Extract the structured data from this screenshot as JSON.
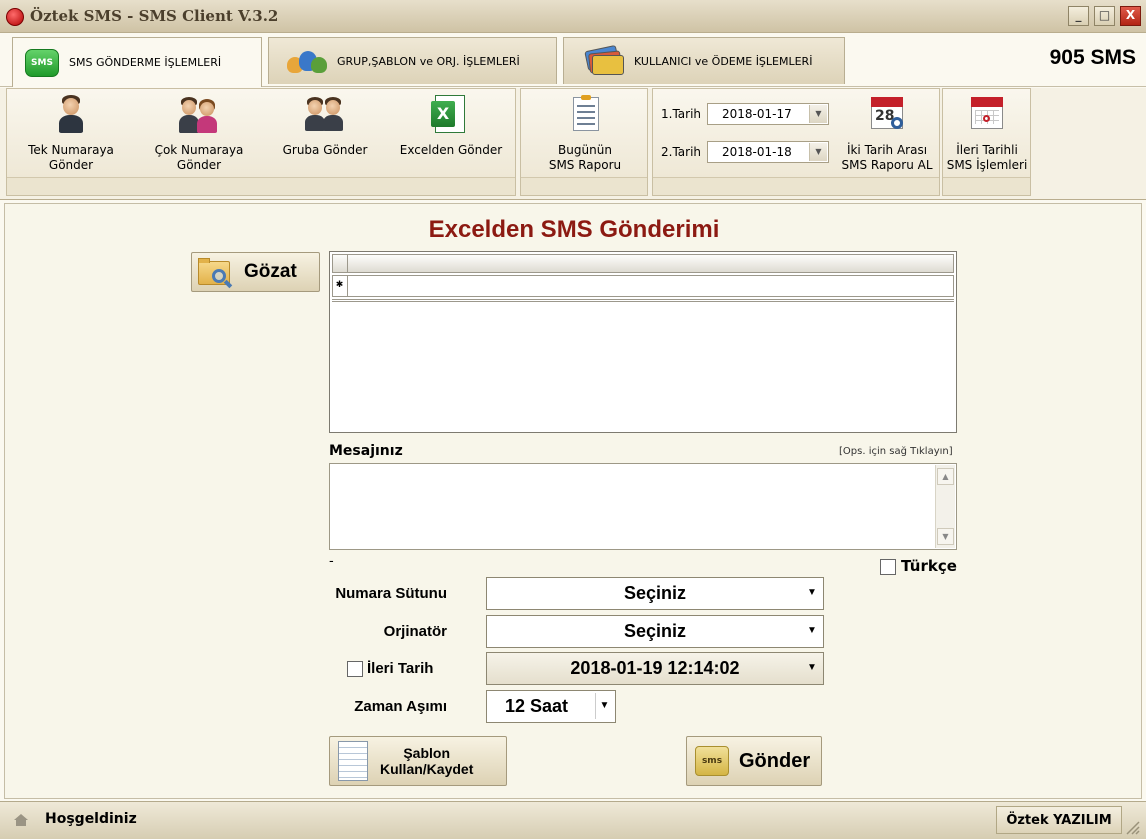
{
  "window": {
    "title": "Öztek SMS - SMS Client  V.3.2",
    "min": "_",
    "max": "□",
    "close": "X"
  },
  "tabs": [
    {
      "label": "SMS GÖNDERME İŞLEMLERİ"
    },
    {
      "label": "GRUP,ŞABLON ve ORJ. İŞLEMLERİ"
    },
    {
      "label": "KULLANICI ve ÖDEME İŞLEMLERİ"
    }
  ],
  "credit": "905 SMS",
  "ribbon": {
    "send": [
      {
        "line1": "Tek Numaraya",
        "line2": "Gönder"
      },
      {
        "line1": "Çok Numaraya",
        "line2": "Gönder"
      },
      {
        "line1": "Gruba Gönder",
        "line2": ""
      },
      {
        "line1": "Excelden Gönder",
        "line2": ""
      }
    ],
    "today_report": {
      "line1": "Bugünün",
      "line2": "SMS Raporu"
    },
    "date1_label": "1.Tarih",
    "date1_value": "2018-01-17",
    "date2_label": "2.Tarih",
    "date2_value": "2018-01-18",
    "range_report": {
      "line1": "İki Tarih Arası",
      "line2": "SMS Raporu AL"
    },
    "scheduled": {
      "line1": "İleri Tarihli",
      "line2": "SMS İşlemleri"
    },
    "calendar_day": "28",
    "sms_badge": "SMS"
  },
  "main": {
    "title": "Excelden SMS Gönderimi",
    "browse_label": "Gözat",
    "message_label": "Mesajınız",
    "message_hint": "[Ops. için sağ Tıklayın]",
    "message_value": "",
    "char_count": "-",
    "turkce_label": "Türkçe",
    "turkce_checked": false,
    "form": {
      "numara_label": "Numara Sütunu",
      "numara_value": "Seçiniz",
      "orj_label": "Orjinatör",
      "orj_value": "Seçiniz",
      "ileri_label": "İleri Tarih",
      "ileri_checked": false,
      "ileri_value": "2018-01-19 12:14:02",
      "zaman_label": "Zaman Aşımı",
      "zaman_value": "12 Saat"
    },
    "sablon_line1": "Şablon",
    "sablon_line2": "Kullan/Kaydet",
    "send_label": "Gönder",
    "send_badge": "sms"
  },
  "status": {
    "welcome": "Hoşgeldiniz",
    "company": "Öztek YAZILIM"
  },
  "colors": {
    "title_red": "#8c1a12",
    "chrome": "#e7dfcb"
  }
}
